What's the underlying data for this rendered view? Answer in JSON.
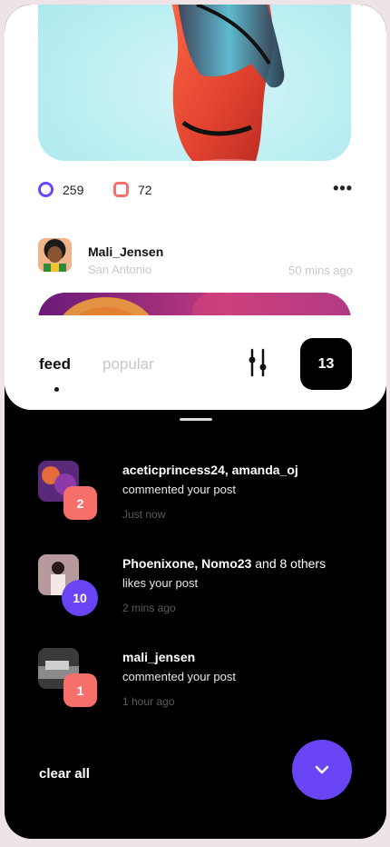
{
  "post": {
    "stats": {
      "comments_count": "259",
      "likes_count": "72"
    },
    "more_label": "•••"
  },
  "author": {
    "name": "Mali_Jensen",
    "location": "San Antonio",
    "time": "50 mins ago"
  },
  "tabs": {
    "feed": "feed",
    "popular": "popular",
    "count": "13"
  },
  "notifications": [
    {
      "users": "aceticprincess24, amanda_oj",
      "rest": "",
      "action": "commented your post",
      "time": "Just now",
      "badge": "2"
    },
    {
      "users": "Phoenixone, Nomo23",
      "rest": " and 8 others",
      "action": "likes your post",
      "time": "2 mins ago",
      "badge": "10"
    },
    {
      "users": "mali_jensen",
      "rest": "",
      "action": "commented your post",
      "time": "1 hour ago",
      "badge": "1"
    }
  ],
  "footer": {
    "clear_all": "clear all"
  },
  "colors": {
    "accent_purple": "#6a45f5",
    "accent_coral": "#f66f6a"
  }
}
